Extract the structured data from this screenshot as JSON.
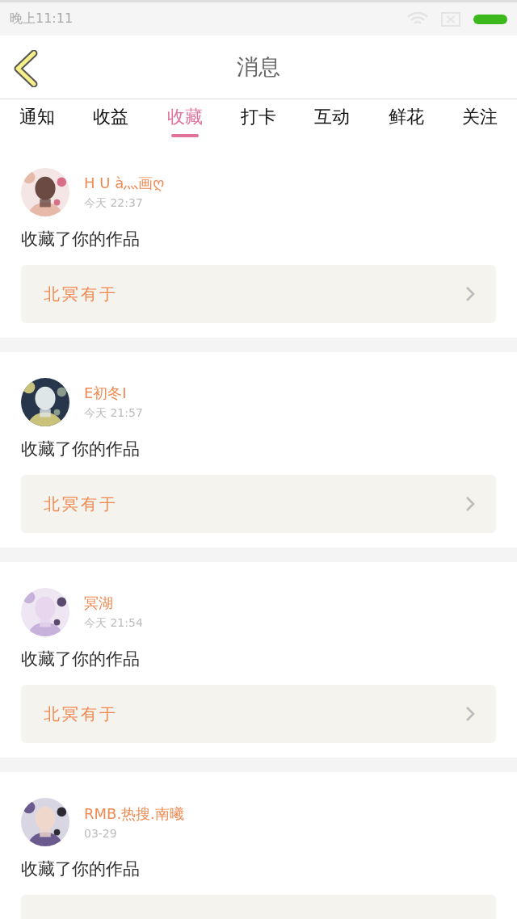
{
  "status_bar": {
    "time": "晚上11:11"
  },
  "header": {
    "title": "消息"
  },
  "tabs": [
    {
      "label": "通知",
      "selected": false
    },
    {
      "label": "收益",
      "selected": false
    },
    {
      "label": "收藏",
      "selected": true
    },
    {
      "label": "打卡",
      "selected": false
    },
    {
      "label": "互动",
      "selected": false
    },
    {
      "label": "鲜花",
      "selected": false
    },
    {
      "label": "关注",
      "selected": false
    }
  ],
  "messages": [
    {
      "user": "H U à灬画ღ",
      "time": "今天 22:37",
      "text": "收藏了你的作品",
      "work": "北冥有于"
    },
    {
      "user": "E初冬I",
      "time": "今天 21:57",
      "text": "收藏了你的作品",
      "work": "北冥有于"
    },
    {
      "user": "冥湖",
      "time": "今天 21:54",
      "text": "收藏了你的作品",
      "work": "北冥有于"
    },
    {
      "user": "RMB.热搜.南曦",
      "time": "03-29",
      "text": "收藏了你的作品"
    }
  ]
}
